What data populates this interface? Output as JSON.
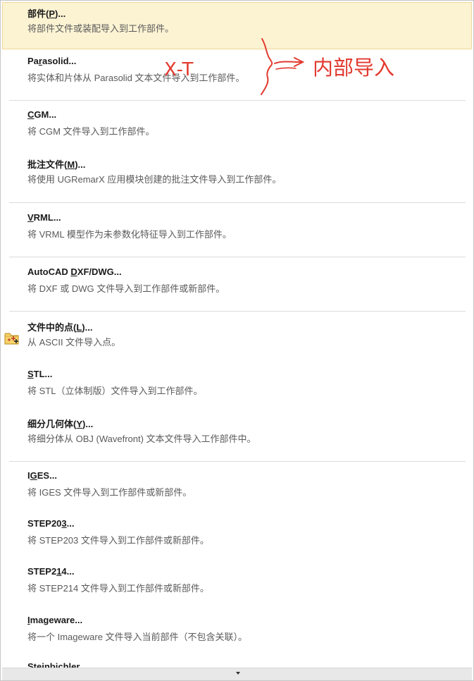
{
  "menu": {
    "items": [
      {
        "title_prefix": "部件(",
        "mnemonic": "P",
        "title_suffix": ")...",
        "desc": "将部件文件或装配导入到工作部件。"
      },
      {
        "title_prefix": "Pa",
        "mnemonic": "r",
        "title_suffix": "asolid...",
        "desc": "将实体和片体从 Parasolid 文本文件导入到工作部件。"
      },
      {
        "title_prefix": "",
        "mnemonic": "C",
        "title_suffix": "GM...",
        "desc": "将 CGM 文件导入到工作部件。"
      },
      {
        "title_prefix": "批注文件(",
        "mnemonic": "M",
        "title_suffix": ")...",
        "desc": "将使用 UGRemarX 应用模块创建的批注文件导入到工作部件。"
      },
      {
        "title_prefix": "",
        "mnemonic": "V",
        "title_suffix": "RML...",
        "desc": "将 VRML 模型作为未参数化特征导入到工作部件。"
      },
      {
        "title_prefix": "AutoCAD ",
        "mnemonic": "D",
        "title_suffix": "XF/DWG...",
        "desc": "将 DXF 或 DWG 文件导入到工作部件或新部件。"
      },
      {
        "title_prefix": "文件中的点(",
        "mnemonic": "L",
        "title_suffix": ")...",
        "desc": "从 ASCII 文件导入点。"
      },
      {
        "title_prefix": "",
        "mnemonic": "S",
        "title_suffix": "TL...",
        "desc": "将 STL（立体制版）文件导入到工作部件。"
      },
      {
        "title_prefix": "细分几何体(",
        "mnemonic": "Y",
        "title_suffix": ")...",
        "desc": "将细分体从 OBJ (Wavefront) 文本文件导入工作部件中。"
      },
      {
        "title_prefix": "I",
        "mnemonic": "G",
        "title_suffix": "ES...",
        "desc": "将 IGES 文件导入到工作部件或新部件。"
      },
      {
        "title_prefix": "STEP20",
        "mnemonic": "3",
        "title_suffix": "...",
        "desc": "将 STEP203 文件导入到工作部件或新部件。"
      },
      {
        "title_prefix": "STEP2",
        "mnemonic": "1",
        "title_suffix": "4...",
        "desc": "将 STEP214 文件导入到工作部件或新部件。"
      },
      {
        "title_prefix": "",
        "mnemonic": "I",
        "title_suffix": "mageware...",
        "desc": "将一个 Imageware 文件导入当前部件（不包含关联）。"
      },
      {
        "title_prefix": "Steinbichler",
        "mnemonic": "",
        "title_suffix": "",
        "desc": ""
      }
    ]
  },
  "annotation": {
    "xt": "X-T",
    "internal_import": "内部导入",
    "color": "#e23a2f"
  },
  "icons": {
    "points_from_file": "folder-points-icon",
    "scroll_down": "scroll-down-arrow-icon"
  },
  "colors": {
    "highlight_bg": "#fcf3d3",
    "highlight_border": "#efd89b"
  }
}
